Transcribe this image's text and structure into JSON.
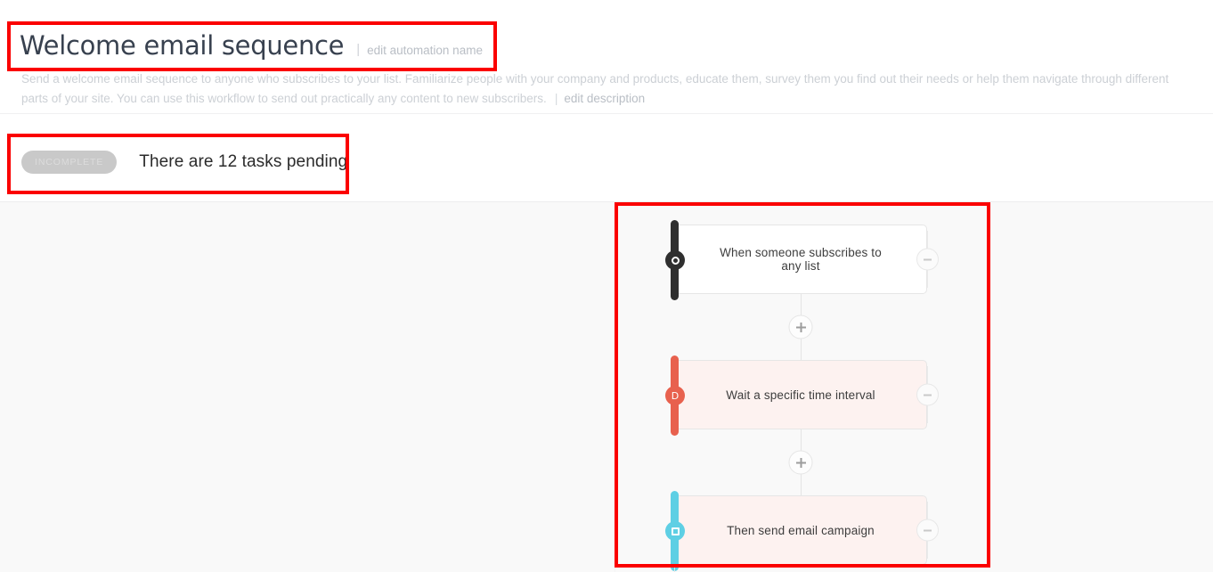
{
  "header": {
    "title": "Welcome email sequence",
    "divider": "|",
    "edit_name_link": "edit automation name",
    "description": "Send a welcome email sequence to anyone who subscribes to your list. Familiarize people with your company and products, educate them, survey them you find out their needs or help them navigate through different parts of your site. You can use this workflow to send out practically any content to new subscribers.",
    "desc_divider": "|",
    "edit_description_link": "edit description"
  },
  "status": {
    "badge": "INCOMPLETE",
    "message": "There are 12 tasks pending",
    "badge_color": "#c9c9c9",
    "badge_text_color": "#dcdcdc"
  },
  "workflow": {
    "nodes": [
      {
        "label": "When someone subscribes to any list",
        "kind": "trigger",
        "accent": "#2f2f2f",
        "icon": "record-circle-icon",
        "remove_label": "remove step"
      },
      {
        "label": "Wait a specific time interval",
        "kind": "action",
        "accent": "#e8614e",
        "icon": "delay-clock-icon",
        "icon_glyph": "D",
        "remove_label": "remove step"
      },
      {
        "label": "Then send email campaign",
        "kind": "action",
        "accent": "#5ecfe4",
        "icon": "email-square-icon",
        "remove_label": "remove step"
      }
    ],
    "add_step_label": "+",
    "canvas_color": "#f9f9f9"
  },
  "annotations": {
    "color": "#fb0000",
    "boxes": [
      "title-area",
      "status-area",
      "workflow-canvas-area"
    ]
  }
}
